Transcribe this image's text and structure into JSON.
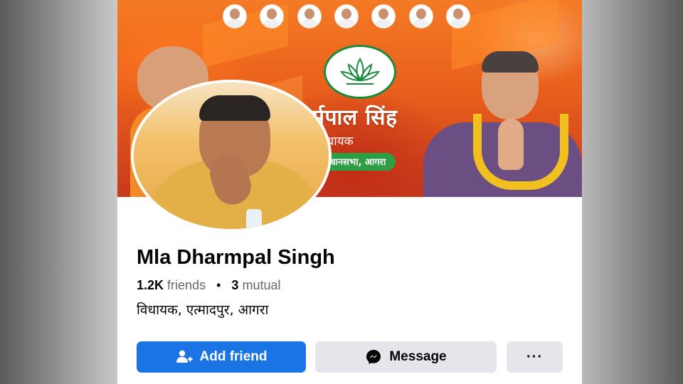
{
  "cover": {
    "title": "र्मपाल सिंह",
    "subtitle": "विधायक",
    "constituency": "विधानसभा, आगरा",
    "leader_count": 7
  },
  "profile": {
    "name": "Mla Dharmpal Singh",
    "friends_count": "1.2K",
    "friends_label": "friends",
    "mutual_count": "3",
    "mutual_label": "mutual",
    "bio": "विधायक, एत्मादपुर, आगरा"
  },
  "actions": {
    "add_friend_label": "Add friend",
    "message_label": "Message",
    "more_label": "···"
  },
  "colors": {
    "primary_button": "#1b74e4",
    "secondary_button": "#e4e6eb",
    "cover_saffron": "#f47a25",
    "pill_green": "#2e9e44"
  },
  "icons": {
    "add_friend": "add-person-icon",
    "message": "messenger-icon",
    "more": "more-dots-icon"
  }
}
